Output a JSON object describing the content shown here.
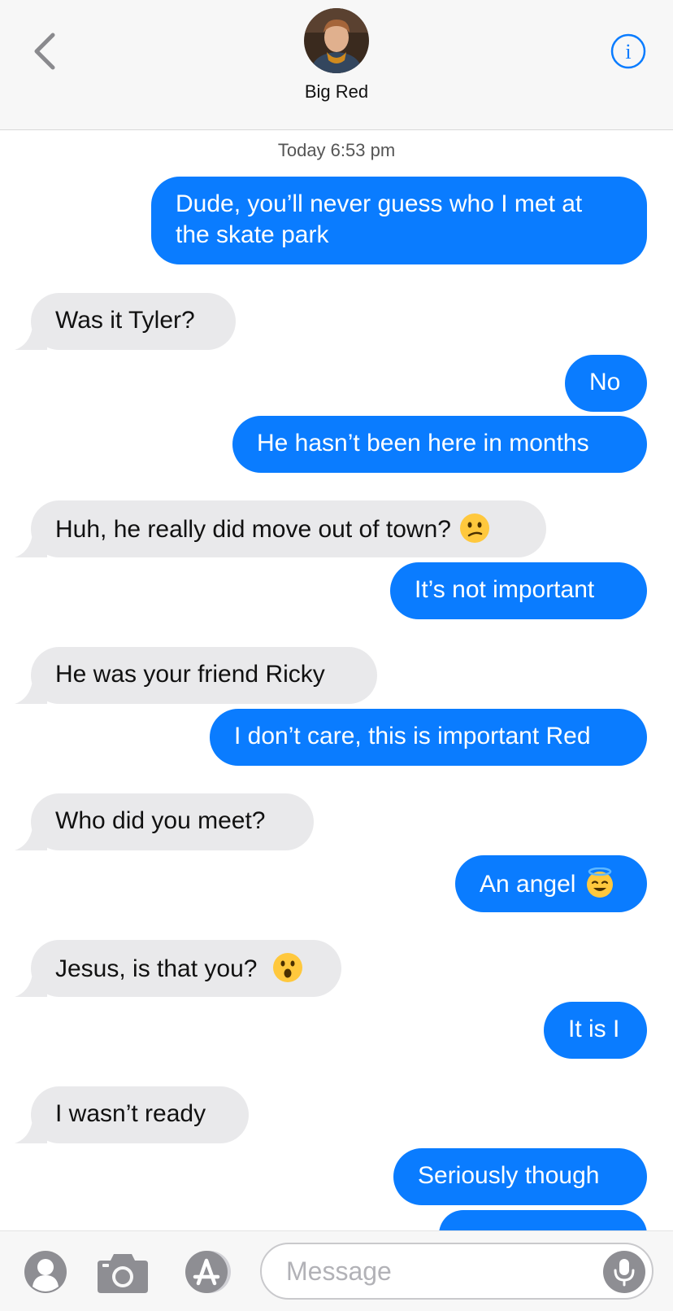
{
  "header": {
    "contact_name": "Big Red",
    "back_icon": "chevron-left-icon",
    "info_icon": "info-circle-icon"
  },
  "conversation": {
    "timestamp": "Today 6:53 pm",
    "messages": [
      {
        "dir": "sent",
        "text": "Dude, you’ll never guess who I met at",
        "text2": "the skate park"
      },
      {
        "dir": "received",
        "text": "Was it Tyler?"
      },
      {
        "dir": "sent",
        "text": "No"
      },
      {
        "dir": "sent",
        "text": "He hasn’t been here in months"
      },
      {
        "dir": "received",
        "text": "Huh, he really did move out of town?",
        "emoji": "confused-face-emoji"
      },
      {
        "dir": "sent",
        "text": "It’s not important"
      },
      {
        "dir": "received",
        "text": "He was your friend Ricky"
      },
      {
        "dir": "sent",
        "text": "I don’t care, this is important Red"
      },
      {
        "dir": "received",
        "text": "Who did you meet?"
      },
      {
        "dir": "sent",
        "text": "An angel",
        "emoji": "halo-face-emoji"
      },
      {
        "dir": "received",
        "text": "Jesus, is that you? ",
        "emoji": "surprised-face-emoji"
      },
      {
        "dir": "sent",
        "text": "It is I"
      },
      {
        "dir": "received",
        "text": "I wasn’t ready"
      },
      {
        "dir": "sent",
        "text": "Seriously though"
      }
    ]
  },
  "input_bar": {
    "placeholder": "Message",
    "icons": [
      "memoji-icon",
      "camera-icon",
      "app-store-icon",
      "microphone-icon"
    ]
  },
  "colors": {
    "sent_bubble": "#0a7cff",
    "received_bubble": "#e9e9eb",
    "accent": "#0a7cff"
  }
}
